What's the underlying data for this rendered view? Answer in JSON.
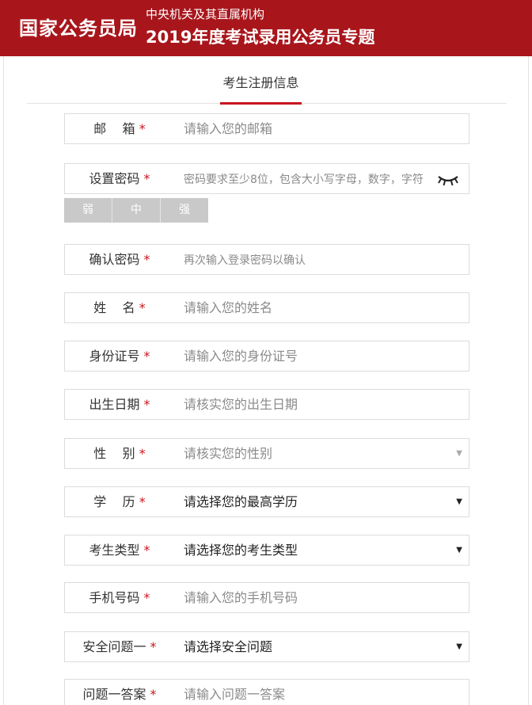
{
  "header": {
    "brand": "国家公务员局",
    "subtitle_line1": "中央机关及其直属机构",
    "subtitle_line2": "2019年度考试录用公务员专题",
    "color": "#a8161c"
  },
  "tab": {
    "label": "考生注册信息",
    "accent": "#c9151e"
  },
  "form": {
    "email": {
      "label": "邮    箱",
      "placeholder": "请输入您的邮箱"
    },
    "password": {
      "label": "设置密码",
      "placeholder": "密码要求至少8位，包含大小写字母，数字，字符",
      "toggle_icon": "eye-closed-icon"
    },
    "strength": {
      "weak": "弱",
      "medium": "中",
      "strong": "强"
    },
    "confirm": {
      "label": "确认密码",
      "placeholder": "再次输入登录密码以确认"
    },
    "name": {
      "label": "姓    名",
      "placeholder": "请输入您的姓名"
    },
    "id_number": {
      "label": "身份证号",
      "placeholder": "请输入您的身份证号"
    },
    "birth": {
      "label": "出生日期",
      "placeholder": "请核实您的出生日期"
    },
    "gender": {
      "label": "性    别",
      "value": "请核实您的性别"
    },
    "education": {
      "label": "学    历",
      "value": "请选择您的最高学历"
    },
    "candidate_type": {
      "label": "考生类型",
      "value": "请选择您的考生类型"
    },
    "phone": {
      "label": "手机号码",
      "placeholder": "请输入您的手机号码"
    },
    "security_q1": {
      "label": "安全问题一",
      "value": "请选择安全问题"
    },
    "answer1": {
      "label": "问题一答案",
      "placeholder": "请输入问题一答案"
    },
    "required_mark": "*"
  }
}
